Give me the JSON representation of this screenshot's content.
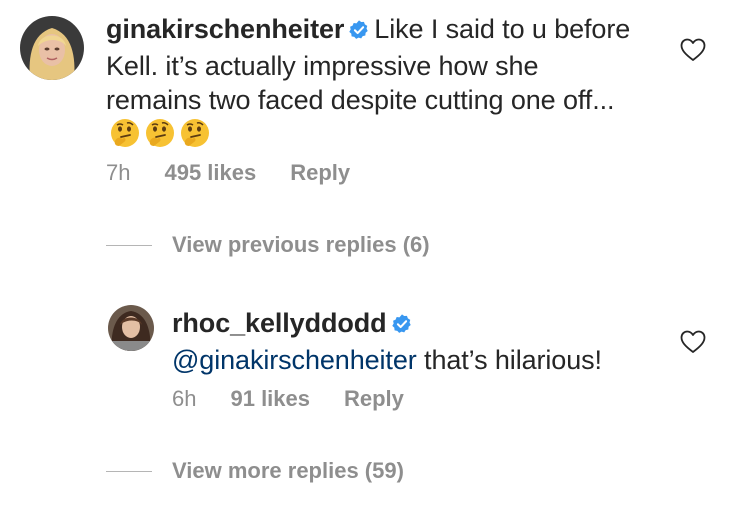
{
  "comments": [
    {
      "username": "ginakirschenheiter",
      "text": "Like I said to u before Kell. it’s actually impressive how she remains two faced despite cutting one off...",
      "emoji_count": 3,
      "emoji_icon": "thinking-face-icon",
      "time": "7h",
      "likes": "495 likes",
      "reply_label": "Reply"
    },
    {
      "username": "rhoc_kellyddodd",
      "mention": "@ginakirschenheiter",
      "text": " that’s hilarious!",
      "time": "6h",
      "likes": "91 likes",
      "reply_label": "Reply"
    }
  ],
  "view_previous_replies": "View previous replies (6)",
  "view_more_replies": "View more replies (59)",
  "colors": {
    "text": "#262626",
    "secondary": "#8e8e8e",
    "mention": "#003569",
    "verified": "#3897f0"
  }
}
